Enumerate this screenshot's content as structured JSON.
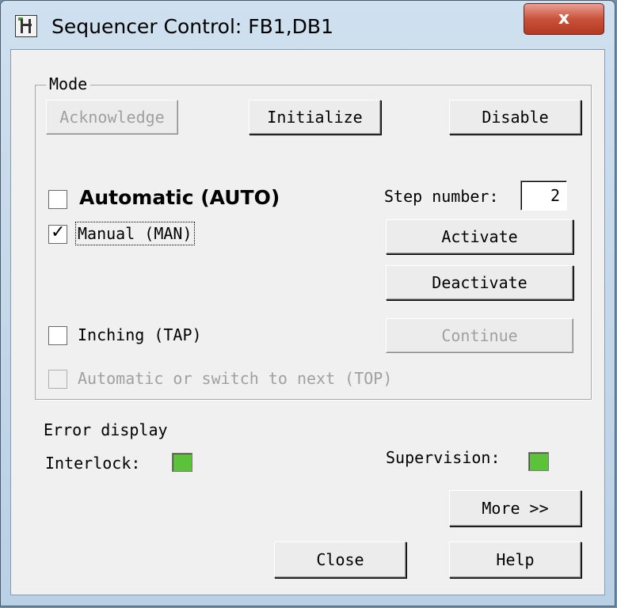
{
  "window": {
    "title": "Sequencer Control: FB1,DB1",
    "close_glyph": "x"
  },
  "mode": {
    "legend": "Mode",
    "buttons": {
      "acknowledge": "Acknowledge",
      "initialize": "Initialize",
      "disable": "Disable"
    },
    "automatic": {
      "label": "Automatic (AUTO)",
      "checked": false,
      "enabled": true
    },
    "manual": {
      "label": "Manual (MAN)",
      "checked": true,
      "enabled": true
    },
    "inching": {
      "label": "Inching (TAP)",
      "checked": false,
      "enabled": true
    },
    "auto_next": {
      "label": "Automatic or switch to next (TOP)",
      "checked": false,
      "enabled": false
    },
    "step_number": {
      "label": "Step number:",
      "value": "2"
    },
    "activate_label": "Activate",
    "deactivate_label": "Deactivate",
    "continue_label": "Continue"
  },
  "errors": {
    "heading": "Error display",
    "interlock_label": "Interlock:",
    "supervision_label": "Supervision:",
    "status_color": "#5cc23a"
  },
  "footer": {
    "more_label": "More >>",
    "close_label": "Close",
    "help_label": "Help"
  }
}
